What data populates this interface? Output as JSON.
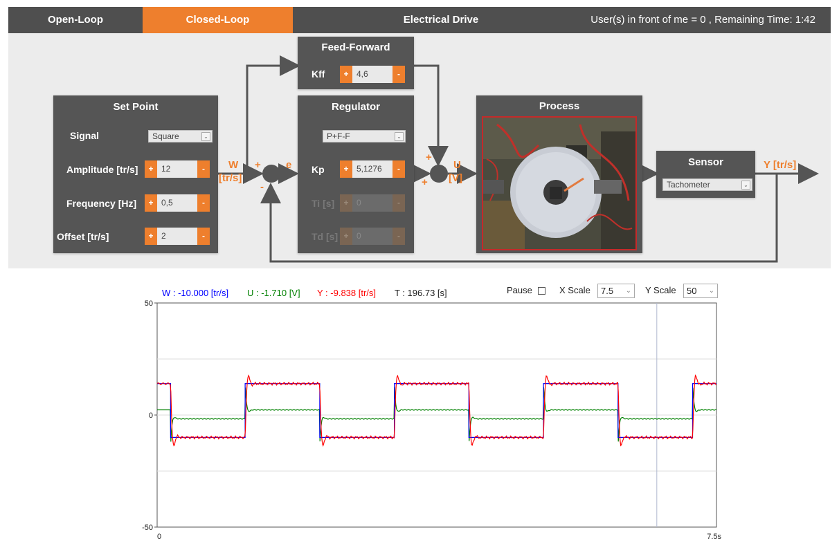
{
  "nav": {
    "open_loop": "Open-Loop",
    "closed_loop": "Closed-Loop",
    "title": "Electrical Drive",
    "status": "User(s) in front of me = 0 , Remaining Time: 1:42"
  },
  "setpoint": {
    "title": "Set Point",
    "signal_label": "Signal",
    "signal_value": "Square",
    "amplitude_label": "Amplitude [tr/s]",
    "amplitude_value": "12",
    "frequency_label": "Frequency [Hz]",
    "frequency_value": "0,5",
    "offset_label": "Offset [tr/s]",
    "offset_value": "2",
    "plus": "+",
    "minus": "-"
  },
  "feedforward": {
    "title": "Feed-Forward",
    "kff_label": "Kff",
    "kff_value": "4,6"
  },
  "regulator": {
    "title": "Regulator",
    "type_value": "P+F-F",
    "kp_label": "Kp",
    "kp_value": "5,1276",
    "ti_label": "Ti [s]",
    "ti_value": "0",
    "td_label": "Td [s]",
    "td_value": "0"
  },
  "process": {
    "title": "Process"
  },
  "sensor": {
    "title": "Sensor",
    "type_value": "Tachometer"
  },
  "signals": {
    "w": "W",
    "w_unit": "[tr/s]",
    "e": "e",
    "u": "U",
    "u_unit": "[V]",
    "y": "Y [tr/s]",
    "plus": "+",
    "minus": "-"
  },
  "readout": {
    "w": "W : -10.000 [tr/s]",
    "u": "U : -1.710 [V]",
    "y": "Y : -9.838 [tr/s]",
    "t": "T : 196.73 [s]"
  },
  "controls": {
    "pause_label": "Pause",
    "xscale_label": "X Scale",
    "xscale_value": "7.5",
    "yscale_label": "Y Scale",
    "yscale_value": "50"
  },
  "colors": {
    "accent": "#ee7f2d",
    "w": "#0000ff",
    "u": "#008000",
    "y": "#ff0000"
  },
  "chart_data": {
    "type": "line",
    "xlim": [
      0,
      7.5
    ],
    "ylim": [
      -50,
      50
    ],
    "x_tick_labels": [
      "0",
      "7.5s"
    ],
    "y_tick_labels": [
      "50",
      "0",
      "-50"
    ],
    "grid": true,
    "series": [
      {
        "name": "W",
        "x": [
          0,
          0.18,
          0.18,
          1.18,
          1.18,
          2.18,
          2.18,
          3.18,
          3.18,
          4.18,
          4.18,
          5.18,
          5.18,
          6.18,
          6.18,
          7.18,
          7.18,
          7.5
        ],
        "values": [
          14,
          14,
          -10,
          -10,
          14,
          14,
          -10,
          -10,
          14,
          14,
          -10,
          -10,
          14,
          14,
          -10,
          -10,
          14,
          14
        ]
      },
      {
        "name": "U",
        "x": [
          0,
          0.18,
          0.18,
          1.18,
          1.18,
          2.18,
          2.18,
          3.18,
          3.18,
          4.18,
          4.18,
          5.18,
          5.18,
          6.18,
          6.18,
          7.18,
          7.18,
          7.5
        ],
        "values": [
          2.3,
          2.3,
          -1.7,
          -1.7,
          2.3,
          2.3,
          -1.7,
          -1.7,
          2.3,
          2.3,
          -1.7,
          -1.7,
          2.3,
          2.3,
          -1.7,
          -1.7,
          2.3,
          2.3
        ]
      },
      {
        "name": "Y",
        "x": [
          0,
          0.18,
          0.18,
          1.18,
          1.18,
          2.18,
          2.18,
          3.18,
          3.18,
          4.18,
          4.18,
          5.18,
          5.18,
          6.18,
          6.18,
          7.18,
          7.18,
          7.5
        ],
        "values": [
          14,
          14,
          -10,
          -10,
          14,
          14,
          -10,
          -10,
          14,
          14,
          -10,
          -10,
          14,
          14,
          -10,
          -10,
          14,
          14
        ]
      }
    ],
    "cursor_x": 6.7
  }
}
